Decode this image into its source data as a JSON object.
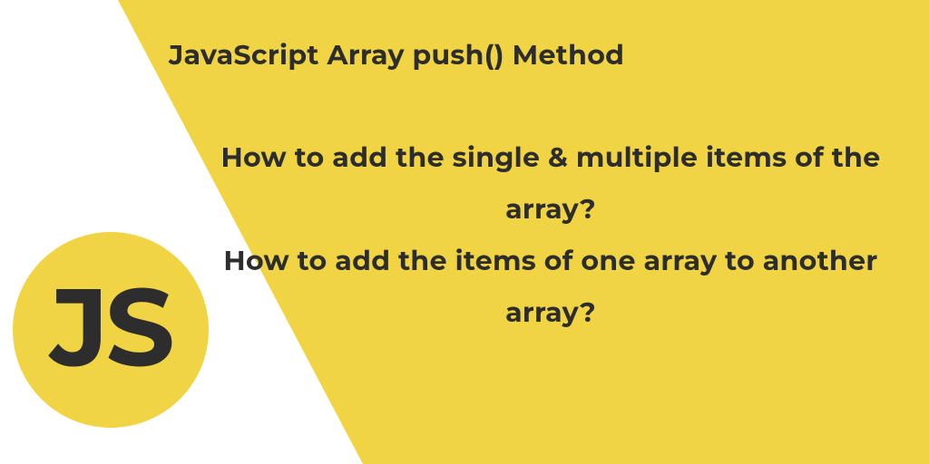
{
  "title": "JavaScript Array push() Method",
  "questions": {
    "q1": "How to add the single & multiple items of the array?",
    "q2": "How to add the items of one array to another array?"
  },
  "logo": {
    "text": "JS"
  },
  "colors": {
    "accent": "#f1d444",
    "text": "#2d2d2d",
    "bg": "#ffffff"
  }
}
